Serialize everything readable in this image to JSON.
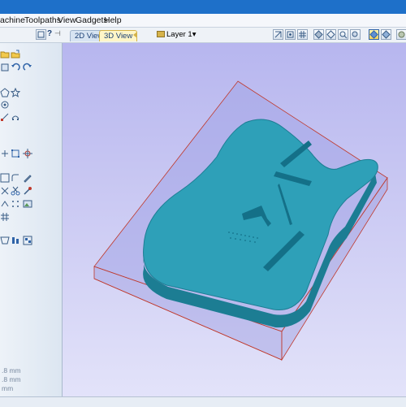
{
  "menu": {
    "items": [
      "achine",
      "Toolpaths",
      "View",
      "Gadgets",
      "Help"
    ]
  },
  "toolbar": {
    "help_glyph": "?",
    "tabs": [
      {
        "label": "2D View",
        "active": false
      },
      {
        "label": "3D View",
        "active": true
      }
    ],
    "layer_label": "Layer 1",
    "layer_arrow": "▾"
  },
  "left_panel": {
    "dims": [
      ".8 mm",
      ".8 mm",
      "mm"
    ]
  },
  "colors": {
    "titlebar": "#1e70c9",
    "part_top": "#2ea0b8",
    "part_side": "#1c7d93",
    "boundary": "#c0392b",
    "viewport_top": "#b7b6ef",
    "viewport_bottom": "#e4e4fa"
  },
  "icons": [
    "folder-icon",
    "save-icon",
    "undo-icon",
    "redo-icon",
    "shape-icon",
    "star-icon",
    "node-icon",
    "weld-icon",
    "trim-icon",
    "move-icon",
    "transform-icon",
    "snap-icon",
    "vector-icon",
    "offset-icon",
    "draw-icon",
    "fillet-icon",
    "knife-icon",
    "toolpath-icon",
    "text-icon",
    "image-icon",
    "array-icon",
    "distort-icon",
    "view-top-icon",
    "view-iso-icon",
    "grid-icon",
    "fit-icon",
    "zoom-icon",
    "render-icon"
  ]
}
